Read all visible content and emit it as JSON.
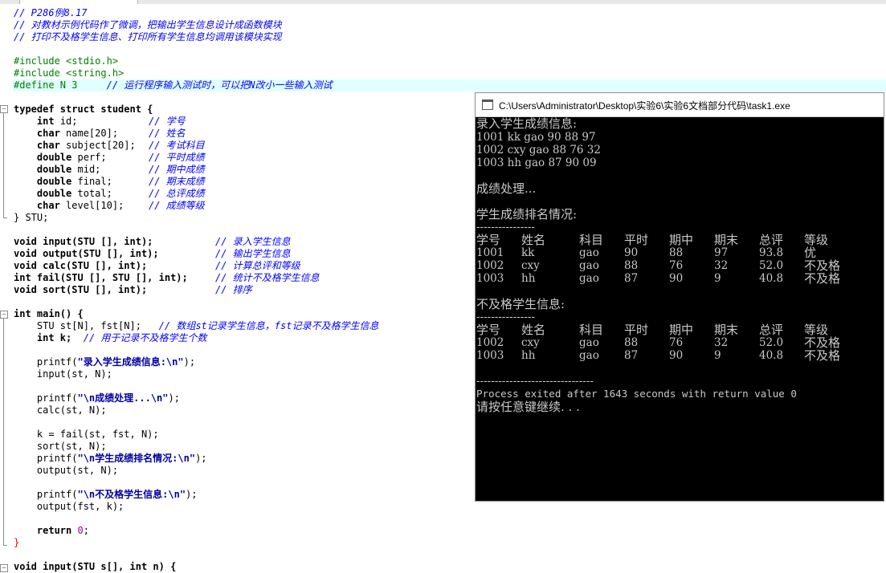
{
  "editor": {
    "comment_lines": [
      "// P286例8.17",
      "// 对教材示例代码作了微调，把输出学生信息设计成函数模块",
      "// 打印不及格学生信息、打印所有学生信息均调用该模块实现"
    ],
    "include1": "#include <stdio.h>",
    "include2": "#include <string.h>",
    "define": "#define N 3",
    "define_comment": "// 运行程序输入测试时，可以把N改小一些输入测试",
    "struct_head": "typedef struct student {",
    "fields": [
      {
        "type": "int",
        "name": " id;",
        "comment": "// 学号"
      },
      {
        "type": "char",
        "name": " name[20];",
        "comment": "// 姓名"
      },
      {
        "type": "char",
        "name": " subject[20];",
        "comment": "// 考试科目"
      },
      {
        "type": "double",
        "name": " perf;",
        "comment": "// 平时成绩"
      },
      {
        "type": "double",
        "name": " mid;",
        "comment": "// 期中成绩"
      },
      {
        "type": "double",
        "name": " final;",
        "comment": "// 期末成绩"
      },
      {
        "type": "double",
        "name": " total;",
        "comment": "// 总评成绩"
      },
      {
        "type": "char",
        "name": " level[10];",
        "comment": "// 成绩等级"
      }
    ],
    "struct_end": "} STU;",
    "protos": [
      {
        "text": "void input(STU [], int);",
        "comment": "// 录入学生信息"
      },
      {
        "text": "void output(STU [], int);",
        "comment": "// 输出学生信息"
      },
      {
        "text": "void calc(STU [], int);",
        "comment": "// 计算总评和等级"
      },
      {
        "text": "int fail(STU [], STU [], int);",
        "comment": "// 统计不及格学生信息"
      },
      {
        "text": "void sort(STU [], int);",
        "comment": "// 排序"
      }
    ],
    "main_head": "int main() {",
    "decl1": "STU st[N], fst[N];",
    "decl1_comment": "// 数组st记录学生信息，fst记录不及格学生信息",
    "decl2": "int k;",
    "decl2_comment": "// 用于记录不及格学生个数",
    "printf1": "\"录入学生成绩信息:\\n\"",
    "input_call": "input(st, N);",
    "printf2": "\"\\n成绩处理...\\n\"",
    "calc_call": "calc(st, N);",
    "fail_call": "k = fail(st, fst, N);",
    "sort_call": "sort(st, N);",
    "printf3": "\"\\n学生成绩排名情况:\\n\"",
    "output_call1": "output(st, N);",
    "printf4": "\"\\n不及格学生信息:\\n\"",
    "output_call2": "output(fst, k);",
    "return_kw": "return",
    "return_val": "0",
    "main_end": "}",
    "next_fn": "void input(STU s[], int n) {"
  },
  "console": {
    "title": "C:\\Users\\Administrator\\Desktop\\实验6\\实验6文档部分代码\\task1.exe",
    "input_header": "录入学生成绩信息:",
    "input_lines": [
      "1001 kk gao 90 88 97",
      "1002 cxy gao 88 76 32",
      "1003 hh gao 87 90 09"
    ],
    "processing": "成绩处理...",
    "ranking_header": "学生成绩排名情况:",
    "fail_header": "不及格学生信息:",
    "dashes_short": "----------------",
    "columns": [
      "学号",
      "姓名",
      "科目",
      "平时",
      "期中",
      "期末",
      "总评",
      "等级"
    ],
    "ranking_rows": [
      [
        "1001",
        "kk",
        "gao",
        "90",
        "88",
        "97",
        "93.8",
        "优"
      ],
      [
        "1002",
        "cxy",
        "gao",
        "88",
        "76",
        "32",
        "52.0",
        "不及格"
      ],
      [
        "1003",
        "hh",
        "gao",
        "87",
        "90",
        "9",
        "40.8",
        "不及格"
      ]
    ],
    "fail_rows": [
      [
        "1002",
        "cxy",
        "gao",
        "88",
        "76",
        "32",
        "52.0",
        "不及格"
      ],
      [
        "1003",
        "hh",
        "gao",
        "87",
        "90",
        "9",
        "40.8",
        "不及格"
      ]
    ],
    "dashes_long": "--------------------------------",
    "exit_line": "Process exited after 1643 seconds with return value 0",
    "press_key": "请按任意键继续. . ."
  }
}
